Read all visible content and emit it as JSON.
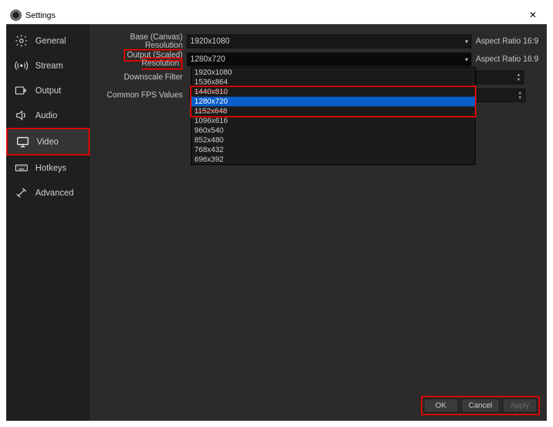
{
  "window": {
    "title": "Settings",
    "close": "✕"
  },
  "sidebar": {
    "items": [
      {
        "label": "General"
      },
      {
        "label": "Stream"
      },
      {
        "label": "Output"
      },
      {
        "label": "Audio"
      },
      {
        "label": "Video"
      },
      {
        "label": "Hotkeys"
      },
      {
        "label": "Advanced"
      }
    ]
  },
  "video": {
    "base_label": "Base (Canvas) Resolution",
    "base_value": "1920x1080",
    "base_aspect": "Aspect Ratio 16:9",
    "output_label": "Output (Scaled) Resolution",
    "output_value": "1280x720",
    "output_aspect": "Aspect Ratio 16:9",
    "downscale_label": "Downscale Filter",
    "fps_label": "Common FPS Values",
    "dropdown_options": [
      "1920x1080",
      "1536x864",
      "1440x810",
      "1280x720",
      "1152x648",
      "1096x616",
      "960x540",
      "852x480",
      "768x432",
      "696x392"
    ]
  },
  "footer": {
    "ok": "OK",
    "cancel": "Cancel",
    "apply": "Apply"
  }
}
